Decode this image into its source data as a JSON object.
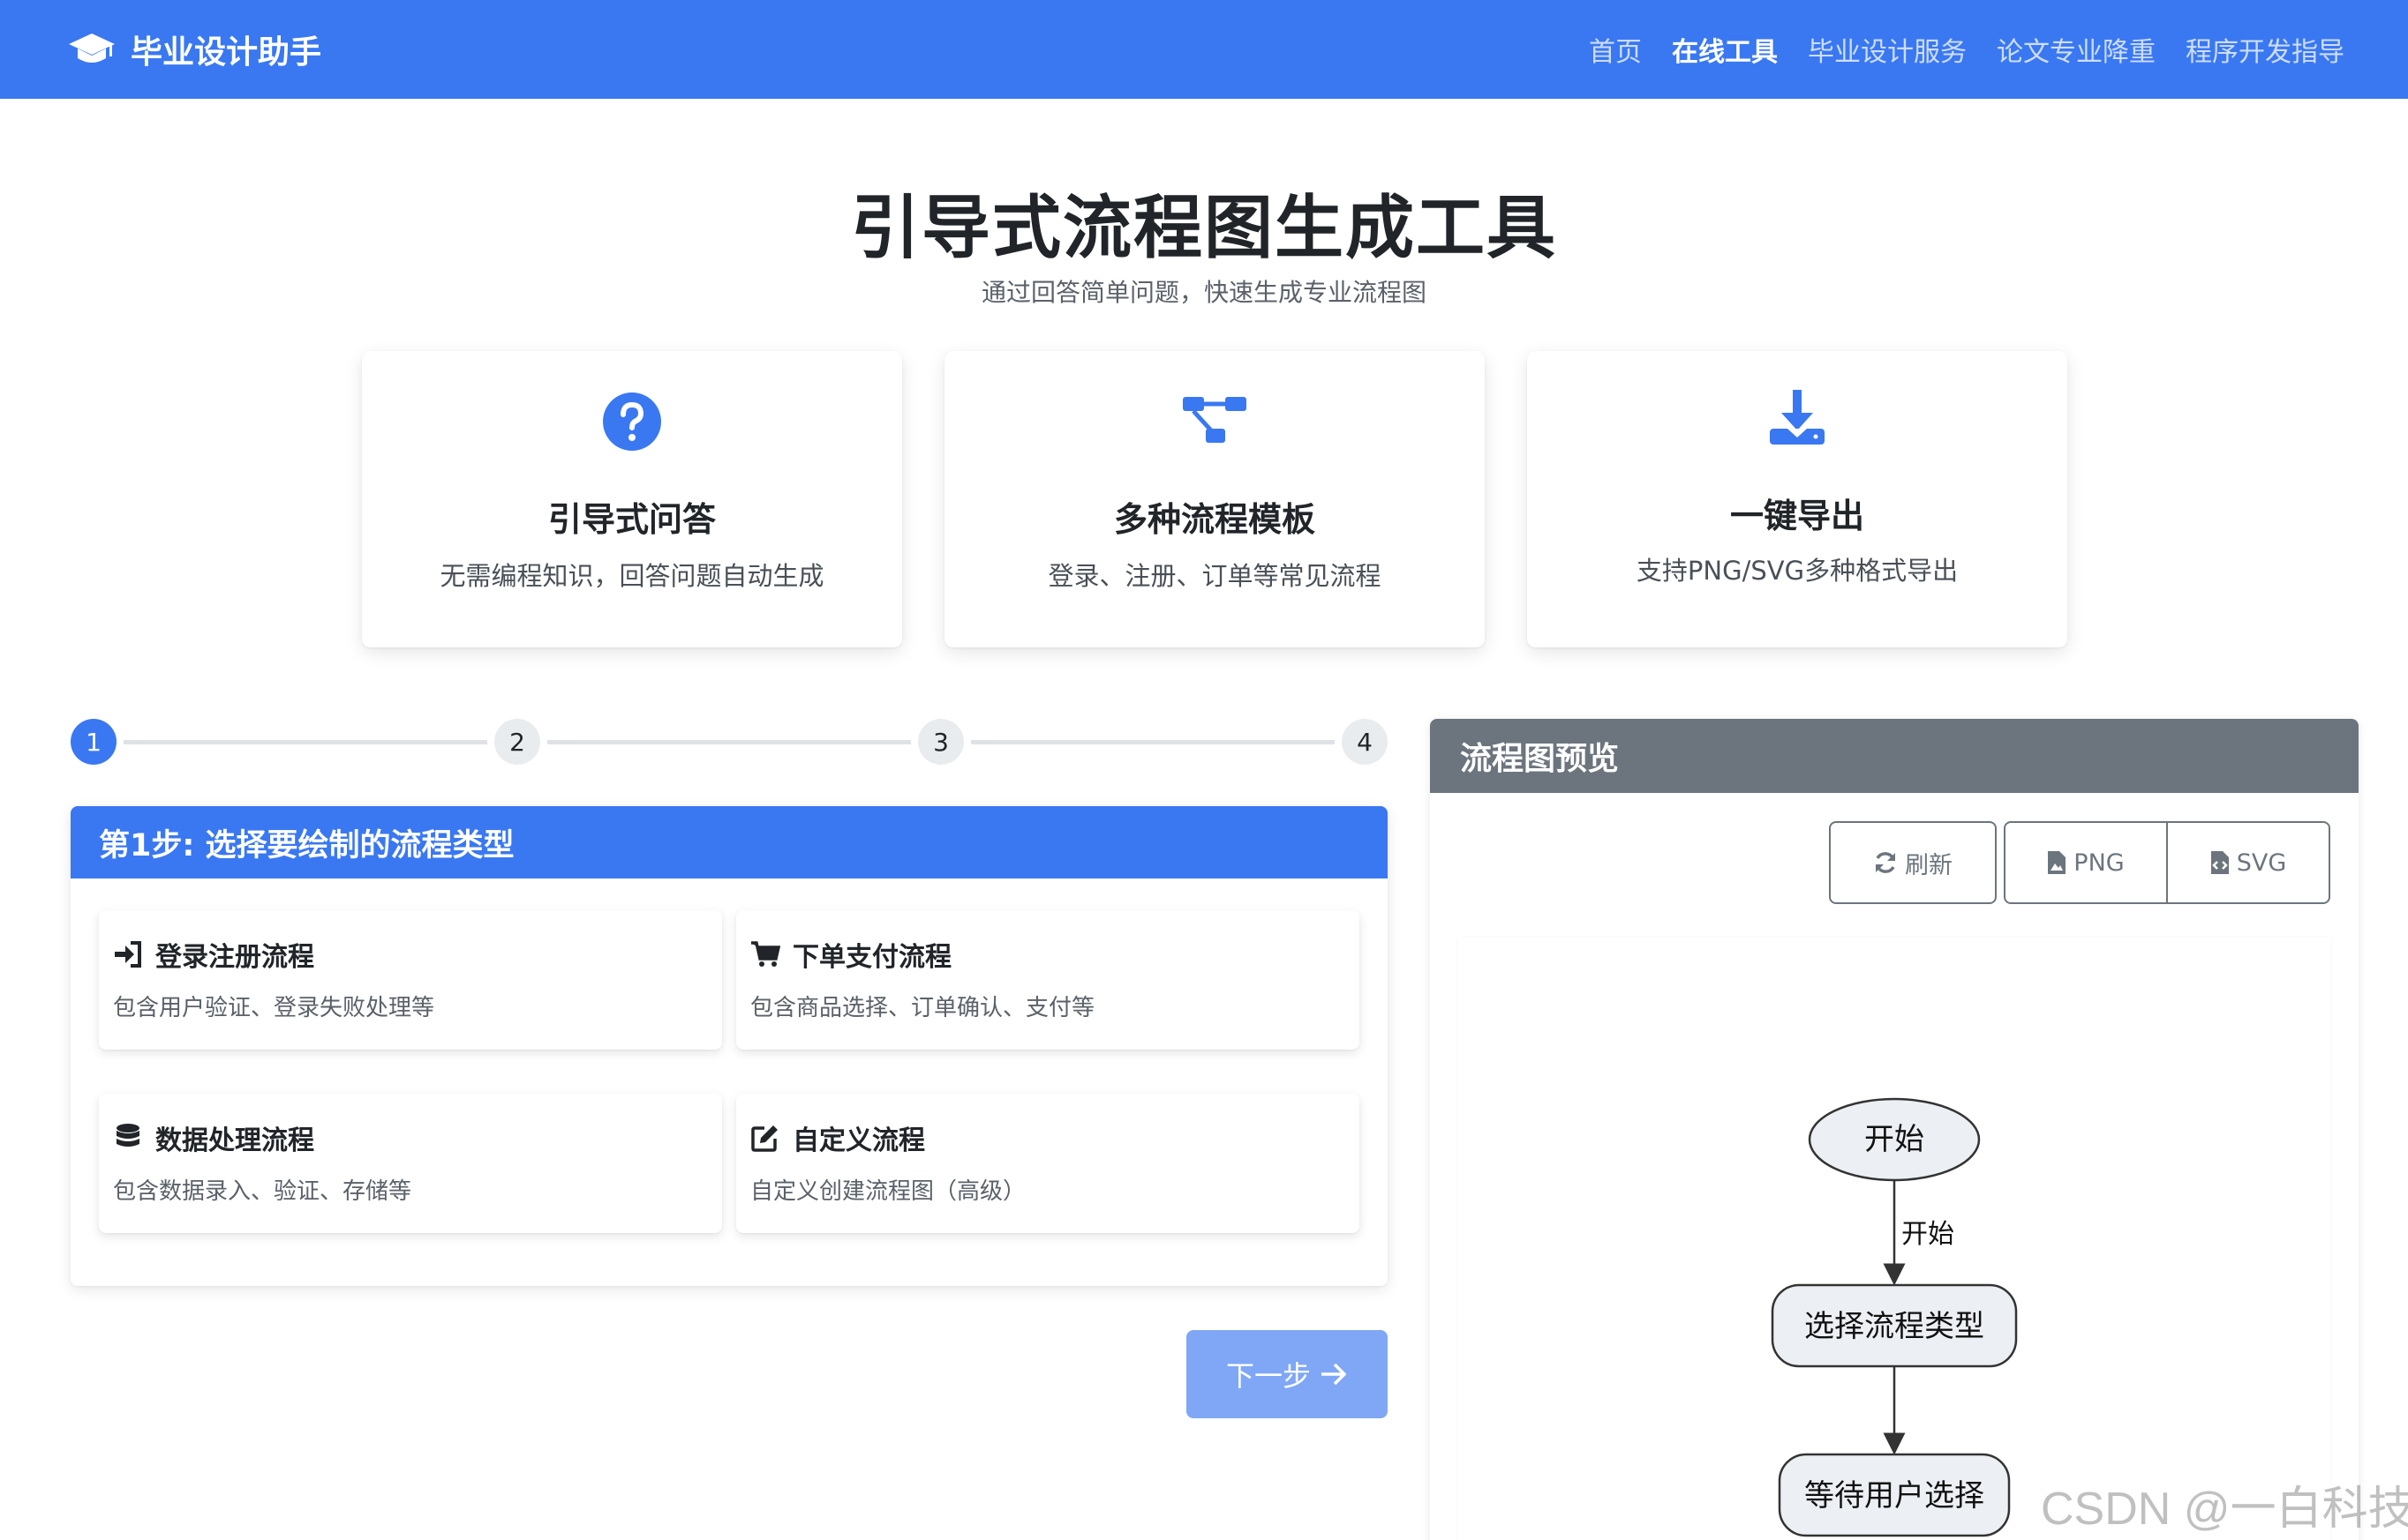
{
  "navbar": {
    "brand": "毕业设计助手",
    "links": [
      "首页",
      "在线工具",
      "毕业设计服务",
      "论文专业降重",
      "程序开发指导"
    ]
  },
  "hero": {
    "title": "引导式流程图生成工具",
    "subtitle": "通过回答简单问题，快速生成专业流程图"
  },
  "features": [
    {
      "icon": "question-circle-icon",
      "title": "引导式问答",
      "desc": "无需编程知识，回答问题自动生成"
    },
    {
      "icon": "flow-diagram-icon",
      "title": "多种流程模板",
      "desc": "登录、注册、订单等常见流程"
    },
    {
      "icon": "download-icon",
      "title": "一键导出",
      "desc": "支持PNG/SVG多种格式导出"
    }
  ],
  "stepper": {
    "steps": [
      "1",
      "2",
      "3",
      "4"
    ],
    "active": 1
  },
  "step_card": {
    "title": "第1步: 选择要绘制的流程类型",
    "options": [
      {
        "icon": "sign-in-icon",
        "title": "登录注册流程",
        "desc": "包含用户验证、登录失败处理等"
      },
      {
        "icon": "shopping-cart-icon",
        "title": "下单支付流程",
        "desc": "包含商品选择、订单确认、支付等"
      },
      {
        "icon": "database-icon",
        "title": "数据处理流程",
        "desc": "包含数据录入、验证、存储等"
      },
      {
        "icon": "edit-icon",
        "title": "自定义流程",
        "desc": "自定义创建流程图（高级）"
      }
    ]
  },
  "next_button": "下一步",
  "preview": {
    "title": "流程图预览",
    "refresh": "刷新",
    "png": "PNG",
    "svg": "SVG",
    "diagram": {
      "start": "开始",
      "edge_label": "开始",
      "node1": "选择流程类型",
      "node2": "等待用户选择"
    }
  },
  "watermark": "CSDN @一白科技",
  "colors": {
    "primary": "#3a78f2",
    "secondary": "#6c757d"
  }
}
